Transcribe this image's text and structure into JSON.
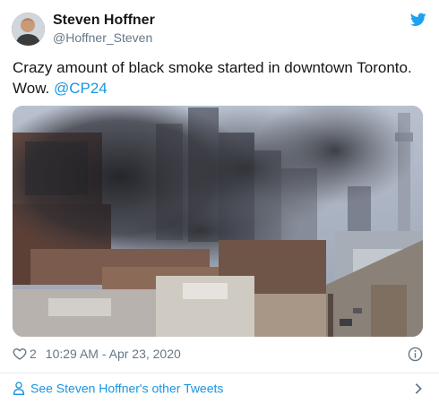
{
  "author": {
    "display_name": "Steven Hoffner",
    "handle": "@Hoffner_Steven"
  },
  "tweet": {
    "text": "Crazy amount of black smoke started in downtown Toronto. Wow. ",
    "mention": "@CP24"
  },
  "meta": {
    "likes": "2",
    "timestamp": "10:29 AM - Apr 23, 2020"
  },
  "footer": {
    "other_tweets_label": "See Steven Hoffner's other Tweets"
  },
  "icons": {
    "brand": "twitter-bird-icon",
    "like": "heart-icon",
    "info": "info-icon",
    "profile": "person-icon",
    "more": "chevron-right-icon"
  },
  "colors": {
    "twitter_blue": "#1da1f2",
    "link": "#1b95e0",
    "muted": "#657786",
    "text": "#14171a"
  }
}
